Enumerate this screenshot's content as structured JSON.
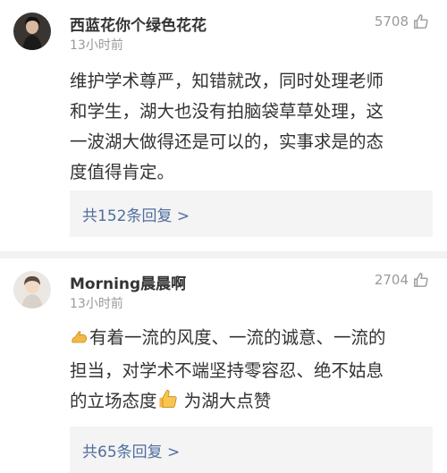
{
  "comments": [
    {
      "username": "西蓝花你个绿色花花",
      "time": "13小时前",
      "likes": "5708",
      "lines": [
        "维护学术尊严，知错就改，同时处理老师",
        "和学生，湖大也没有拍脑袋草草处理，这",
        "一波湖大做得还是可以的，实事求是的态",
        "度值得肯定。"
      ],
      "replies": "共152条回复 >"
    },
    {
      "username": "Morning晨晨啊",
      "time": "13小时前",
      "likes": "2704",
      "line1": "有着一流的风度、一流的诚意、一流的",
      "line2": "担当，对学术不端坚持零容忍、绝不姑息",
      "line3a": "的立场态度",
      "line3b": " 为湖大点赞",
      "replies": "共65条回复 >"
    }
  ],
  "icons": {
    "like": "thumbs-up-outline-icon",
    "emoji1": "flexed-biceps-emoji",
    "emoji2": "thumbs-up-emoji"
  },
  "colors": {
    "link": "#4f6e9e",
    "meta": "#9a9a9a",
    "reply_bg": "#f4f4f4"
  }
}
